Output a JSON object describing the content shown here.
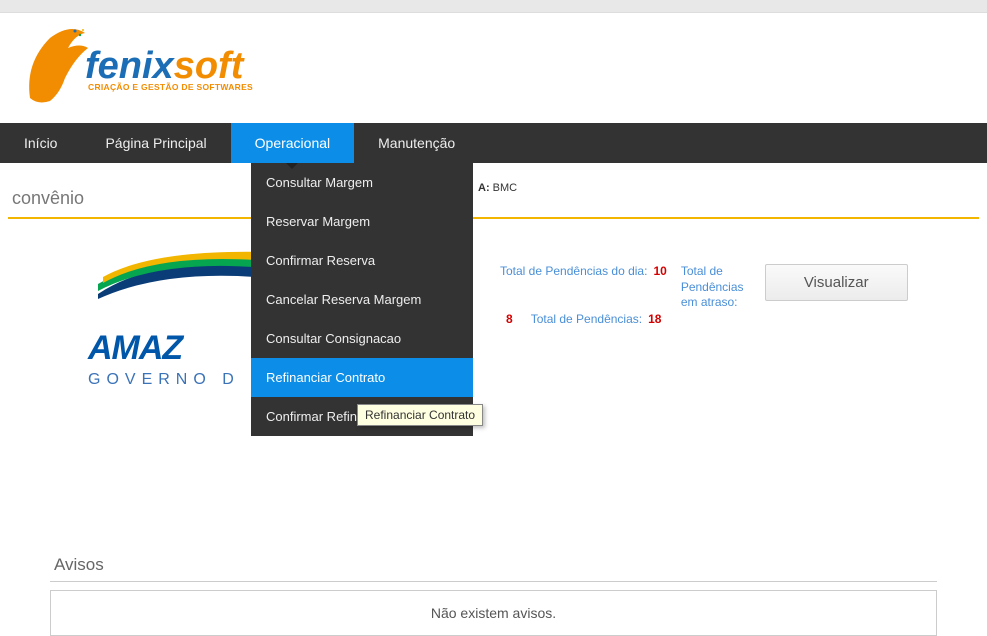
{
  "brand": {
    "prefix": "fenix",
    "suffix": "soft",
    "tagline": "CRIAÇÃO E GESTÃO DE SOFTWARES"
  },
  "nav": {
    "items": [
      "Início",
      "Página Principal",
      "Operacional",
      "Manutenção"
    ],
    "active_index": 2
  },
  "dropdown": {
    "items": [
      "Consultar Margem",
      "Reservar Margem",
      "Confirmar Reserva",
      "Cancelar Reserva Margem",
      "Consultar Consignacao",
      "Refinanciar Contrato",
      "Confirmar Refinar"
    ],
    "hover_index": 5
  },
  "tooltip": "Refinanciar Contrato",
  "hidden": {
    "label_suffix": "A:",
    "value": "BMC"
  },
  "page": {
    "section_title": "convênio"
  },
  "gov_logo": {
    "main": "AMAZ",
    "sub": "GOVERNO D"
  },
  "stats": {
    "l1_label": "Total de Pendências do dia:",
    "l1_value": "10",
    "l2_label": "Total de Pendências em atraso:",
    "btn": "Visualizar",
    "l3_value_a": "8",
    "l3_label": "Total de Pendências:",
    "l3_value_b": "18"
  },
  "avisos": {
    "title": "Avisos",
    "empty": "Não existem avisos."
  }
}
